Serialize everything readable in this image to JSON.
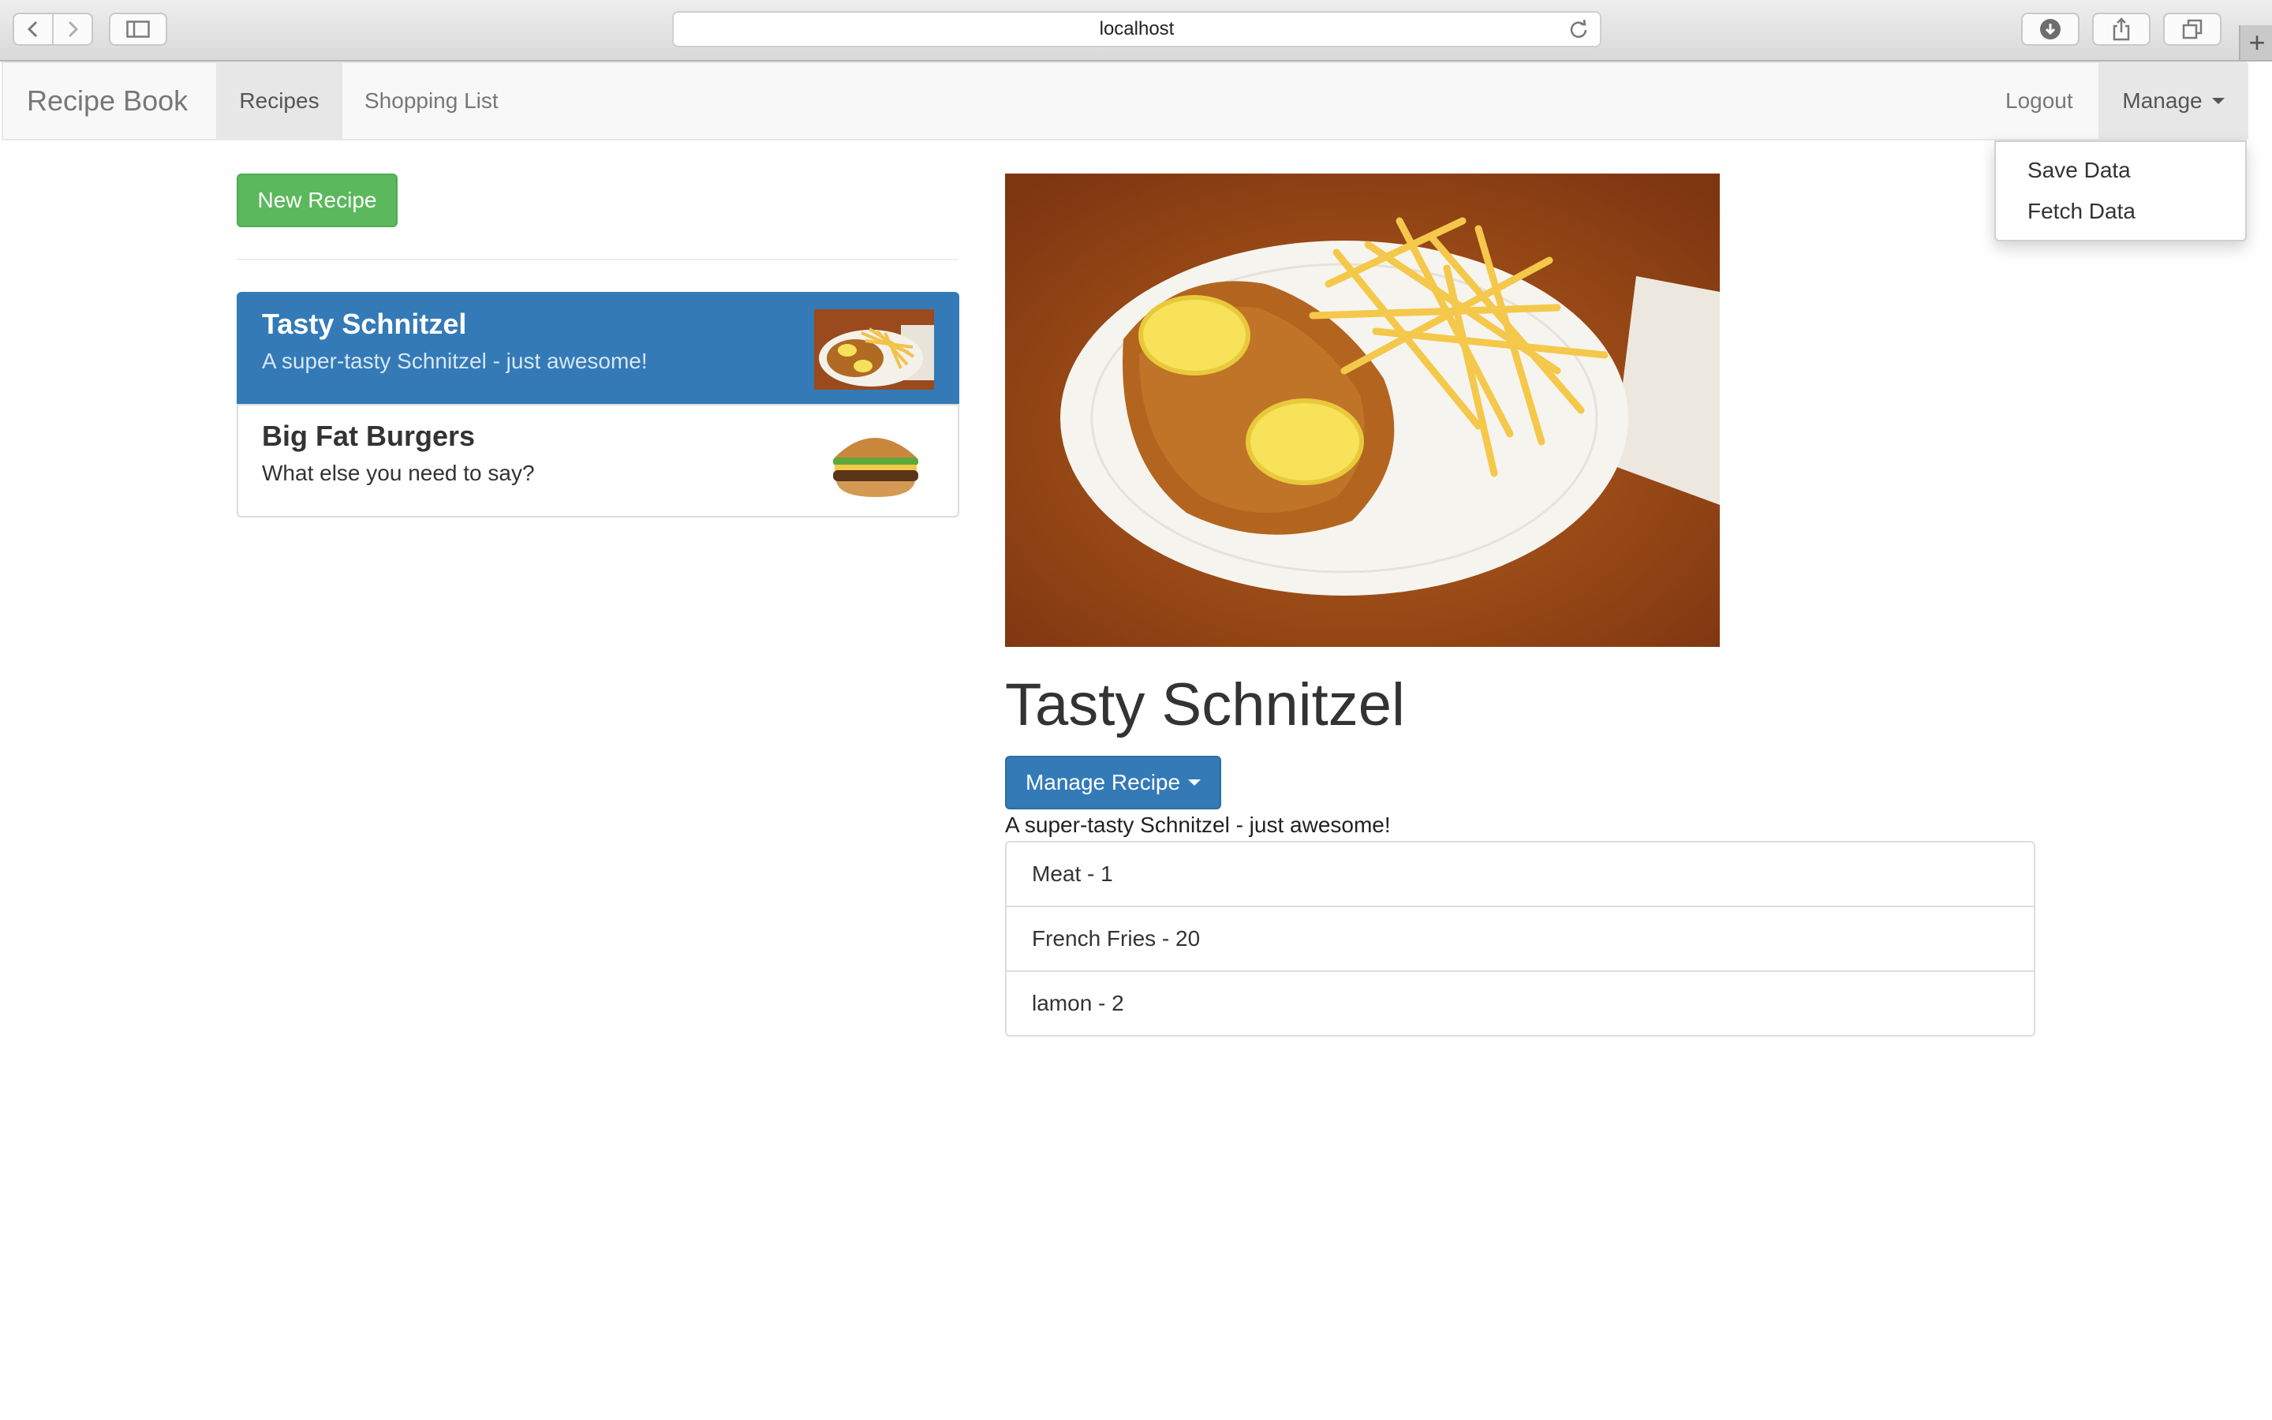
{
  "browser": {
    "url": "localhost",
    "icons": [
      "back-icon",
      "forward-icon",
      "sidebar-icon",
      "reload-icon",
      "download-icon",
      "share-icon",
      "tabs-icon",
      "new-tab-icon"
    ]
  },
  "navbar": {
    "brand": "Recipe Book",
    "items": [
      {
        "label": "Recipes",
        "active": true
      },
      {
        "label": "Shopping List",
        "active": false
      }
    ],
    "logout": "Logout",
    "manage": "Manage",
    "manage_menu": [
      "Save Data",
      "Fetch Data"
    ]
  },
  "sidebar": {
    "new_recipe_label": "New Recipe",
    "recipes": [
      {
        "name": "Tasty Schnitzel",
        "description": "A super-tasty Schnitzel - just awesome!",
        "selected": true
      },
      {
        "name": "Big Fat Burgers",
        "description": "What else you need to say?",
        "selected": false
      }
    ]
  },
  "detail": {
    "title": "Tasty Schnitzel",
    "manage_label": "Manage Recipe",
    "description": "A super-tasty Schnitzel - just awesome!",
    "ingredients": [
      "Meat - 1",
      "French Fries - 20",
      "lamon - 2"
    ]
  },
  "colors": {
    "primary": "#337ab7",
    "success": "#5cb85c",
    "navbar_bg": "#f8f8f8",
    "text": "#333333"
  }
}
